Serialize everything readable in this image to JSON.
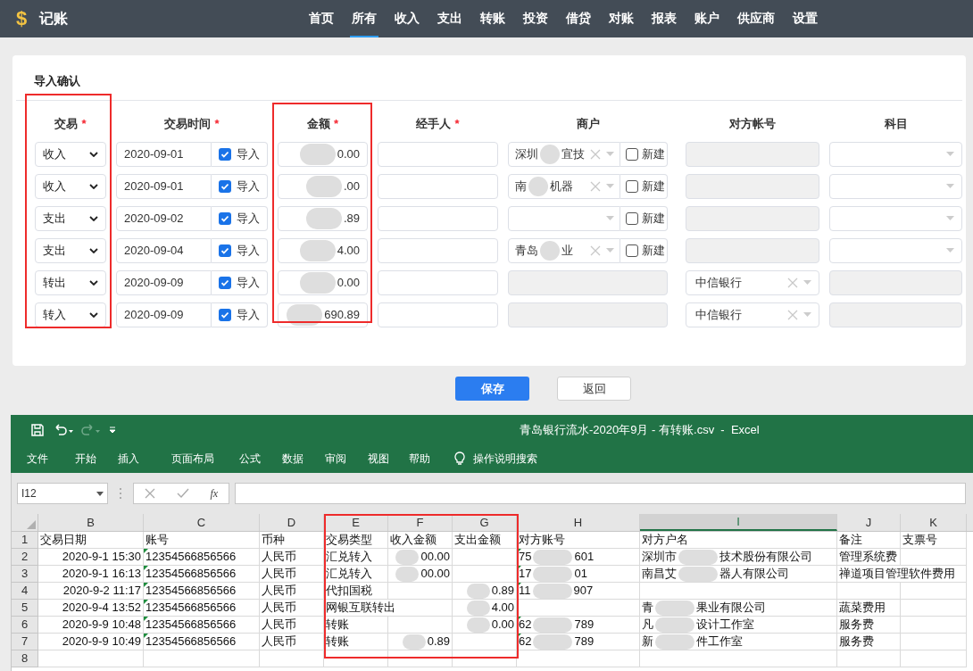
{
  "app": {
    "logo_glyph": "$",
    "title": "记账"
  },
  "nav": [
    {
      "label": "首页",
      "selected": false
    },
    {
      "label": "所有",
      "selected": true
    },
    {
      "label": "收入",
      "selected": false
    },
    {
      "label": "支出",
      "selected": false
    },
    {
      "label": "转账",
      "selected": false
    },
    {
      "label": "投资",
      "selected": false
    },
    {
      "label": "借贷",
      "selected": false
    },
    {
      "label": "对账",
      "selected": false
    },
    {
      "label": "报表",
      "selected": false
    },
    {
      "label": "账户",
      "selected": false
    },
    {
      "label": "供应商",
      "selected": false
    },
    {
      "label": "设置",
      "selected": false
    }
  ],
  "form": {
    "title": "导入确认",
    "columns": [
      {
        "label": "交易",
        "required_mark": "*",
        "highlighted": true
      },
      {
        "label": "交易时间",
        "required_mark": "*",
        "highlighted": false
      },
      {
        "label": "金额",
        "required_mark": "*",
        "highlighted": true
      },
      {
        "label": "经手人",
        "required_mark": "*",
        "highlighted": false
      },
      {
        "label": "商户",
        "highlighted": false
      },
      {
        "label": "对方帐号",
        "highlighted": false
      },
      {
        "label": "科目",
        "highlighted": false
      }
    ],
    "rows": [
      {
        "type": "收入",
        "date": "2020-09-01",
        "import_checked": true,
        "import_label": "导入",
        "amount": "0.00",
        "merchant": {
          "disabled": false,
          "prefix": "深圳",
          "text": "宜技",
          "clearable": true,
          "new_label": "新建",
          "new_checked": false
        },
        "account": {
          "disabled": true
        },
        "subject": {
          "disabled": false
        }
      },
      {
        "type": "收入",
        "date": "2020-09-01",
        "import_checked": true,
        "import_label": "导入",
        "amount": ".00",
        "merchant": {
          "disabled": false,
          "prefix": "南",
          "text": "机器",
          "clearable": true,
          "new_label": "新建",
          "new_checked": false
        },
        "account": {
          "disabled": true
        },
        "subject": {
          "disabled": false
        }
      },
      {
        "type": "支出",
        "date": "2020-09-02",
        "import_checked": true,
        "import_label": "导入",
        "amount": ".89",
        "merchant": {
          "disabled": false,
          "clearable": false,
          "new_label": "新建",
          "new_checked": false
        },
        "account": {
          "disabled": true
        },
        "subject": {
          "disabled": false
        }
      },
      {
        "type": "支出",
        "date": "2020-09-04",
        "import_checked": true,
        "import_label": "导入",
        "amount": "4.00",
        "merchant": {
          "disabled": false,
          "prefix": "青岛",
          "text": "业",
          "clearable": true,
          "new_label": "新建",
          "new_checked": false
        },
        "account": {
          "disabled": true
        },
        "subject": {
          "disabled": false
        }
      },
      {
        "type": "转出",
        "date": "2020-09-09",
        "import_checked": true,
        "import_label": "导入",
        "amount": "0.00",
        "merchant": {
          "disabled": true
        },
        "account": {
          "disabled": false,
          "value": "中信银行",
          "clearable": true
        },
        "subject": {
          "disabled": true
        }
      },
      {
        "type": "转入",
        "date": "2020-09-09",
        "import_checked": true,
        "import_label": "导入",
        "amount": "690.89",
        "merchant": {
          "disabled": true
        },
        "account": {
          "disabled": false,
          "value": "中信银行",
          "clearable": true
        },
        "subject": {
          "disabled": true
        }
      }
    ],
    "buttons": [
      {
        "label": "保存",
        "kind": "primary"
      },
      {
        "label": "返回",
        "kind": "default"
      }
    ]
  },
  "excel": {
    "title": "青岛银行流水-2020年9月 - 有转账.csv  -  Excel",
    "menu": [
      "文件",
      "开始",
      "插入",
      "页面布局",
      "公式",
      "数据",
      "审阅",
      "视图",
      "帮助"
    ],
    "search_label": "操作说明搜索",
    "name_box": "I12",
    "function_label": "fx",
    "columns": [
      {
        "letter": "B",
        "selected": false,
        "highlighted": false
      },
      {
        "letter": "C",
        "selected": false,
        "highlighted": false
      },
      {
        "letter": "D",
        "selected": false,
        "highlighted": false
      },
      {
        "letter": "E",
        "selected": false,
        "highlighted": true
      },
      {
        "letter": "F",
        "selected": false,
        "highlighted": true
      },
      {
        "letter": "G",
        "selected": false,
        "highlighted": true
      },
      {
        "letter": "H",
        "selected": false,
        "highlighted": false
      },
      {
        "letter": "I",
        "selected": true,
        "highlighted": false
      },
      {
        "letter": "J",
        "selected": false,
        "highlighted": false
      },
      {
        "letter": "K",
        "selected": false,
        "highlighted": false
      }
    ],
    "rows": [
      {
        "number": "1",
        "cells": [
          {
            "text": "交易日期"
          },
          {
            "text": "账号"
          },
          {
            "text": "币种"
          },
          {
            "text": "交易类型"
          },
          {
            "text": "收入金额"
          },
          {
            "text": "支出金额"
          },
          {
            "text": "对方账号"
          },
          {
            "text": "对方户名"
          },
          {
            "text": "备注"
          },
          {
            "text": "支票号"
          }
        ]
      },
      {
        "number": "2",
        "cells": [
          {
            "text": "2020-9-1 15:30"
          },
          {
            "text": "12354566856566",
            "flag": true
          },
          {
            "text": "人民币"
          },
          {
            "text": "汇兑转入"
          },
          {
            "text": "00.00",
            "blurred": true
          },
          null,
          {
            "prefix": "75",
            "text": "601",
            "blurred": true,
            "flag": true
          },
          {
            "prefix": "深圳市",
            "text": "技术股份有限公司",
            "blurred": true
          },
          {
            "text": "管理系统费"
          },
          null
        ]
      },
      {
        "number": "3",
        "cells": [
          {
            "text": "2020-9-1 16:13"
          },
          {
            "text": "12354566856566",
            "flag": true
          },
          {
            "text": "人民币"
          },
          {
            "text": "汇兑转入"
          },
          {
            "text": "00.00",
            "blurred": true
          },
          null,
          {
            "prefix": "17",
            "text": "01",
            "blurred": true,
            "flag": true
          },
          {
            "prefix": "南昌艾",
            "text": "器人有限公司",
            "blurred": true
          },
          {
            "text": "禅道项目管理软件费用"
          },
          null
        ]
      },
      {
        "number": "4",
        "cells": [
          {
            "text": "2020-9-2 11:17"
          },
          {
            "text": "12354566856566",
            "flag": true
          },
          {
            "text": "人民币"
          },
          {
            "text": "代扣国税"
          },
          null,
          {
            "text": "0.89",
            "blurred": true
          },
          {
            "prefix": "11",
            "text": "907",
            "blurred": true,
            "flag": true
          },
          null,
          null,
          null
        ]
      },
      {
        "number": "5",
        "cells": [
          {
            "text": "2020-9-4 13:52"
          },
          {
            "text": "12354566856566",
            "flag": true
          },
          {
            "text": "人民币"
          },
          {
            "text": "网银互联转出"
          },
          null,
          {
            "text": "4.00",
            "blurred": true
          },
          null,
          {
            "prefix": "青",
            "text": "果业有限公司",
            "blurred": true
          },
          {
            "text": "蔬菜费用"
          },
          null
        ]
      },
      {
        "number": "6",
        "cells": [
          {
            "text": "2020-9-9 10:48"
          },
          {
            "text": "12354566856566",
            "flag": true
          },
          {
            "text": "人民币"
          },
          {
            "text": "转账"
          },
          null,
          {
            "text": "0.00",
            "blurred": true
          },
          {
            "prefix": "62",
            "text": "789",
            "blurred": true,
            "flag": true
          },
          {
            "prefix": "凡",
            "text": "设计工作室",
            "blurred": true
          },
          {
            "text": "服务费"
          },
          null
        ]
      },
      {
        "number": "7",
        "cells": [
          {
            "text": "2020-9-9 10:49"
          },
          {
            "text": "12354566856566",
            "flag": true
          },
          {
            "text": "人民币"
          },
          {
            "text": "转账"
          },
          {
            "text": "0.89",
            "blurred": true
          },
          null,
          {
            "prefix": "62",
            "text": "789",
            "blurred": true,
            "flag": true
          },
          {
            "prefix": "新",
            "text": "件工作室",
            "blurred": true
          },
          {
            "text": "服务费"
          },
          null
        ]
      },
      {
        "number": "8",
        "cells": [
          null,
          null,
          null,
          null,
          null,
          null,
          null,
          null,
          null,
          null
        ]
      }
    ]
  }
}
